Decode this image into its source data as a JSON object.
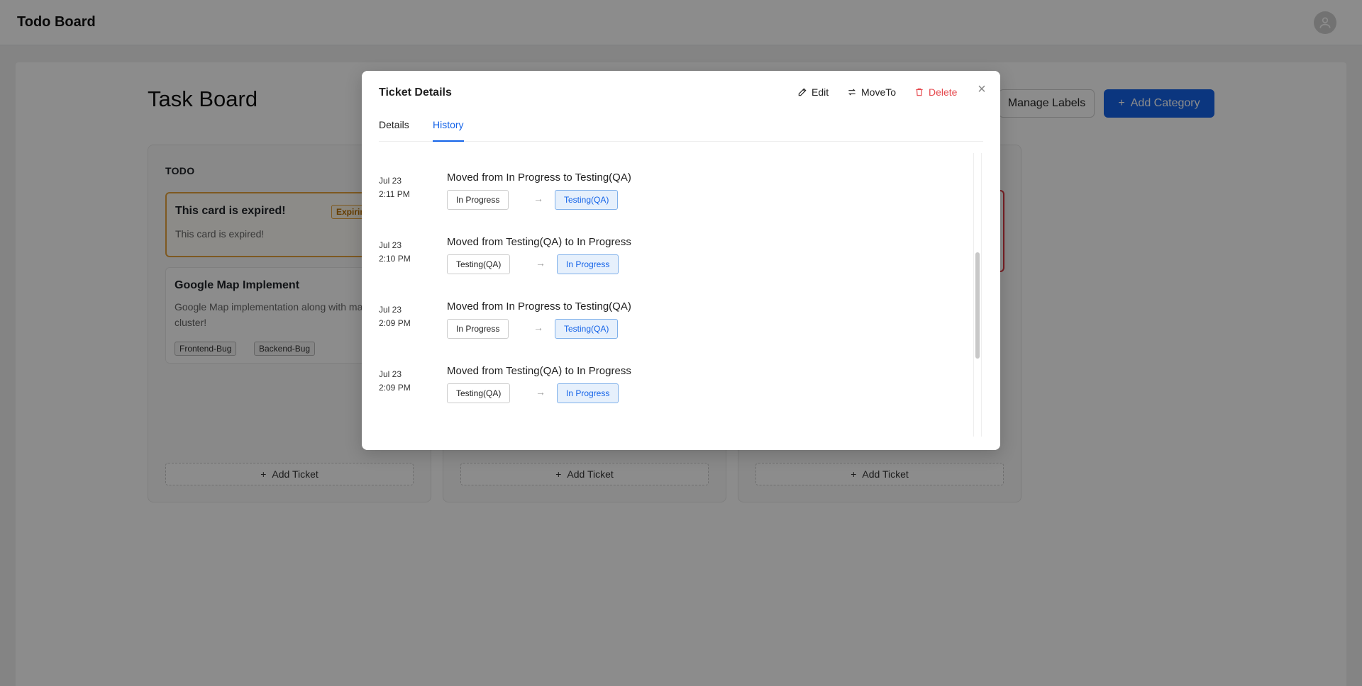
{
  "app": {
    "title": "Todo Board"
  },
  "board": {
    "title": "Task Board",
    "manage_labels": "Manage Labels",
    "add_category": "Add Category",
    "add_ticket": "Add Ticket",
    "columns": [
      {
        "title": "TODO",
        "cards": [
          {
            "title": "This card is expired!",
            "desc": "This card is expired!",
            "badge": "Expiring"
          },
          {
            "title": "Google Map Implement",
            "desc": "Google Map implementation along with marker and cluster!",
            "tags": [
              "Frontend-Bug",
              "Backend-Bug"
            ]
          }
        ]
      }
    ]
  },
  "modal": {
    "title": "Ticket Details",
    "actions": {
      "edit": "Edit",
      "move": "MoveTo",
      "delete": "Delete"
    },
    "tabs": {
      "details": "Details",
      "history": "History"
    },
    "active_tab": "History",
    "history": [
      {
        "date": "Jul 23",
        "time": "2:11 PM",
        "message": "Moved from In Progress to Testing(QA)",
        "from": "In Progress",
        "to": "Testing(QA)"
      },
      {
        "date": "Jul 23",
        "time": "2:10 PM",
        "message": "Moved from Testing(QA) to In Progress",
        "from": "Testing(QA)",
        "to": "In Progress"
      },
      {
        "date": "Jul 23",
        "time": "2:09 PM",
        "message": "Moved from In Progress to Testing(QA)",
        "from": "In Progress",
        "to": "Testing(QA)"
      },
      {
        "date": "Jul 23",
        "time": "2:09 PM",
        "message": "Moved from Testing(QA) to In Progress",
        "from": "Testing(QA)",
        "to": "In Progress"
      }
    ]
  },
  "colors": {
    "accent": "#1463e8",
    "danger": "#e5484d",
    "warning": "#e6a23c"
  }
}
